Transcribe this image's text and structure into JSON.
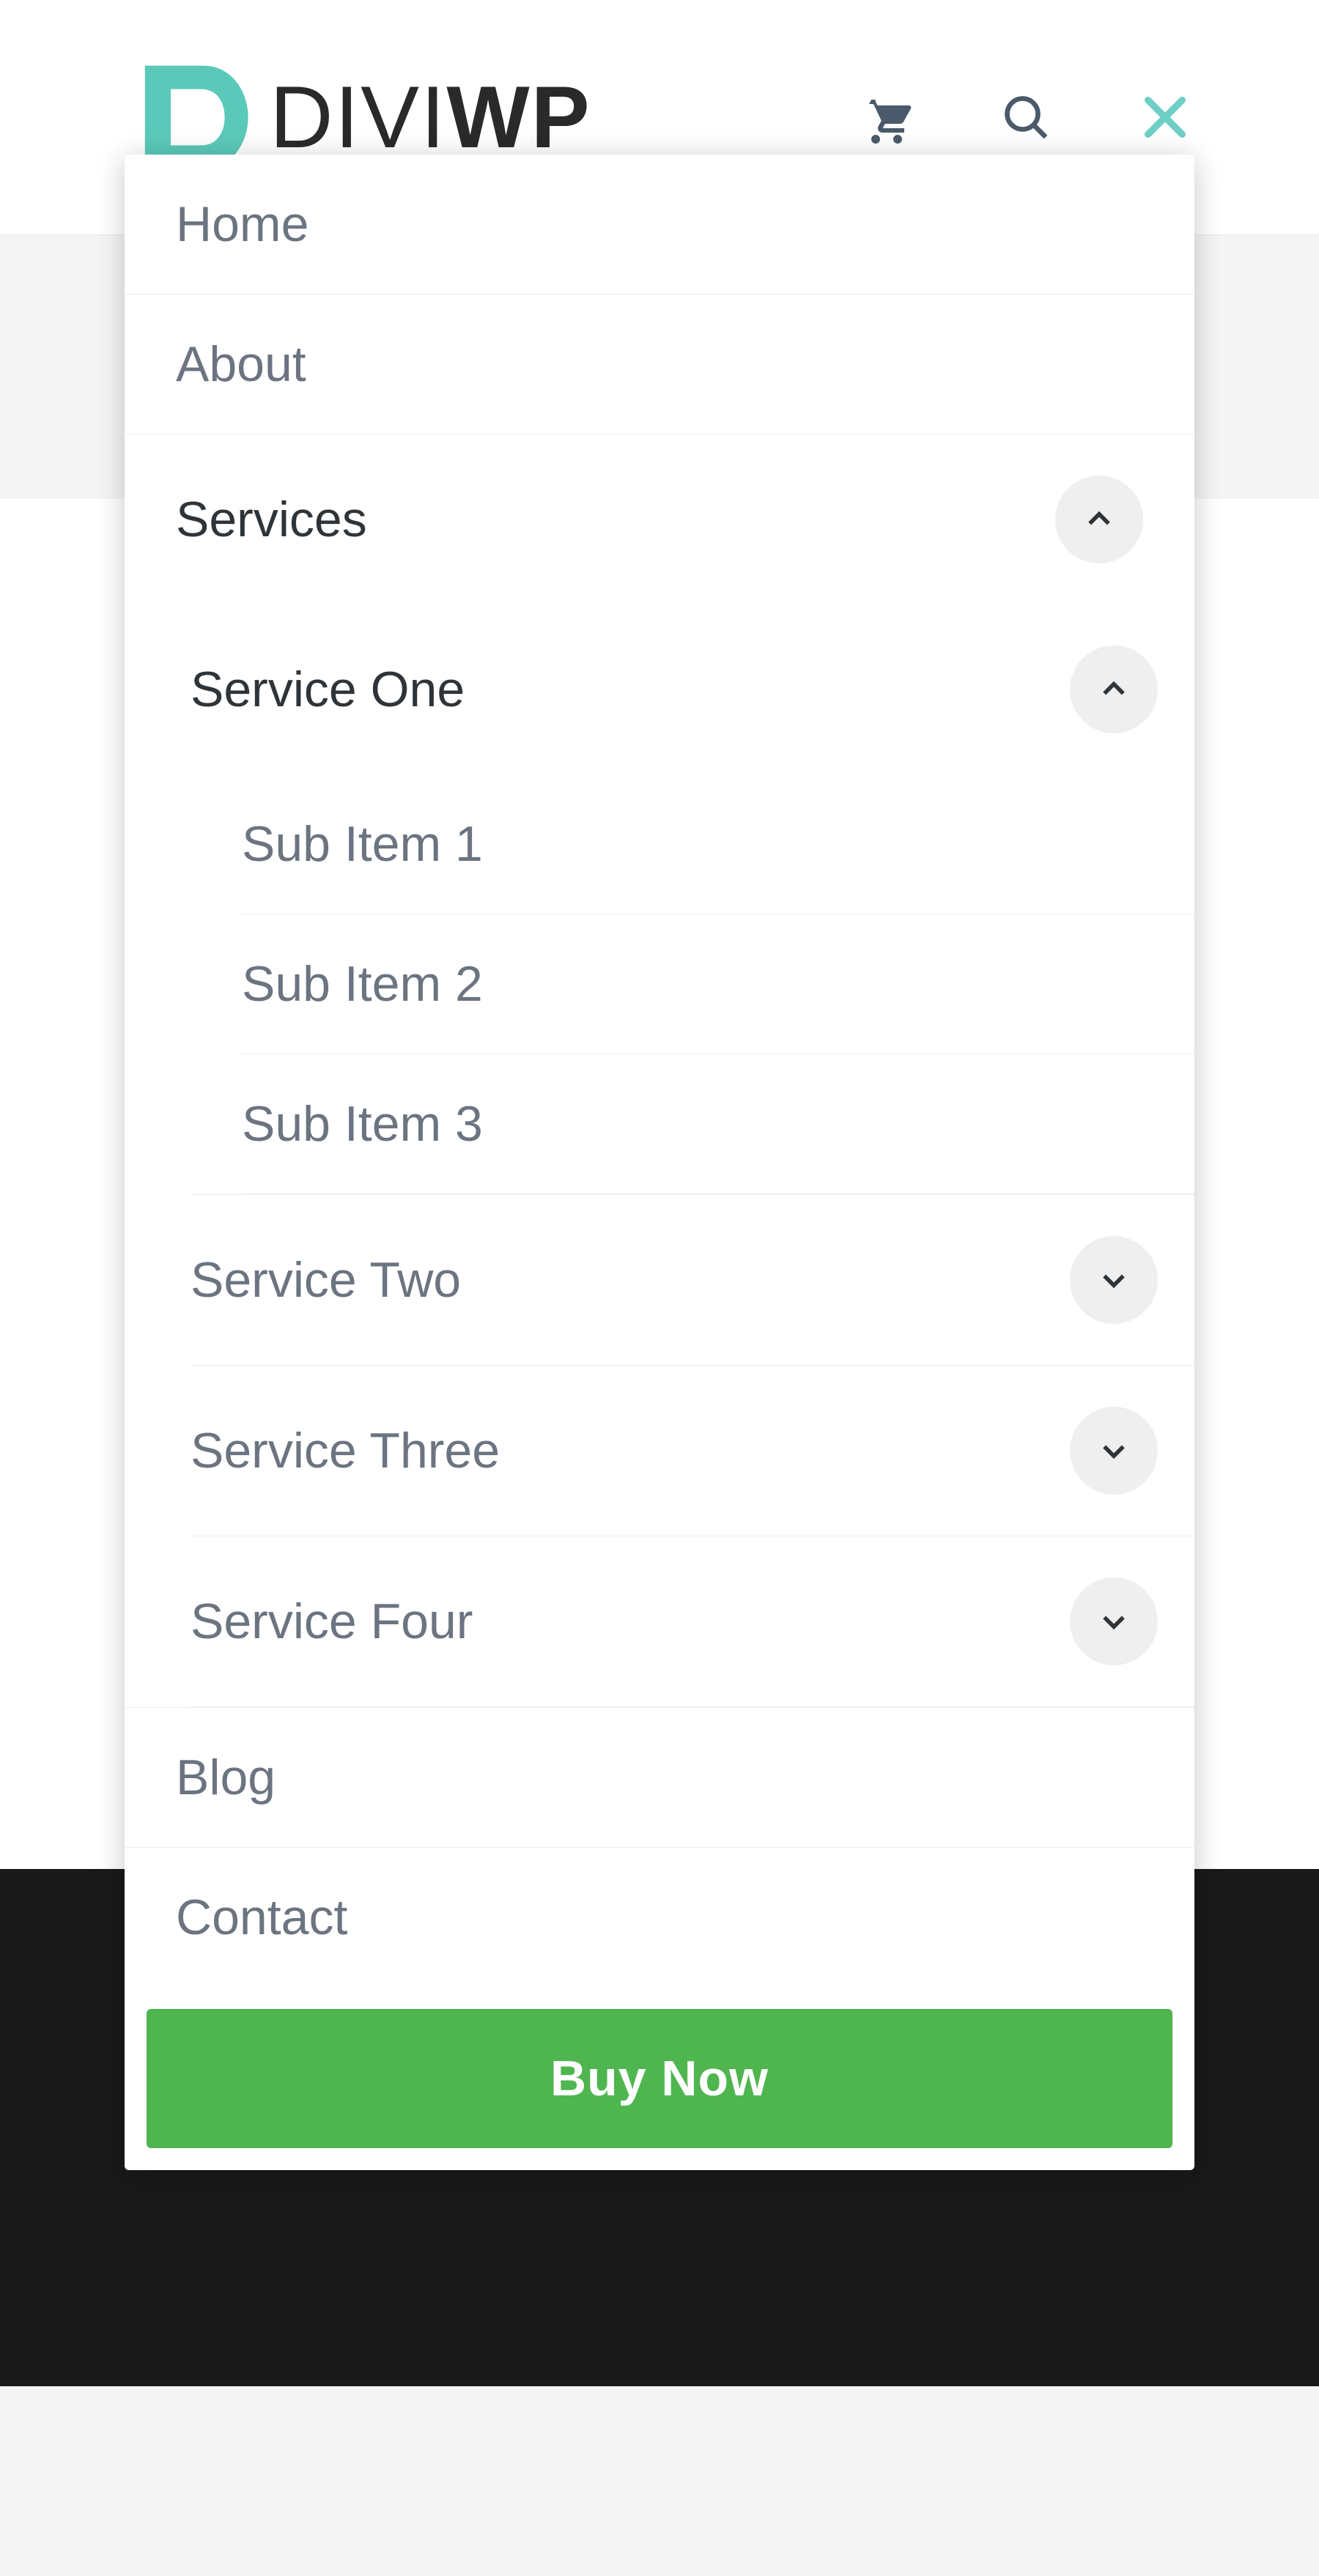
{
  "brand": {
    "name_part1": "DIVI",
    "name_part2": "WP",
    "accent": "#5bc9b9"
  },
  "header": {
    "icons": {
      "cart": "cart-icon",
      "search": "search-icon",
      "close": "close-icon"
    }
  },
  "menu": {
    "items": [
      {
        "label": "Home"
      },
      {
        "label": "About"
      },
      {
        "label": "Services",
        "expanded": true,
        "children": [
          {
            "label": "Service One",
            "expanded": true,
            "children": [
              {
                "label": "Sub Item 1"
              },
              {
                "label": "Sub Item 2"
              },
              {
                "label": "Sub Item 3"
              }
            ]
          },
          {
            "label": "Service Two",
            "expanded": false,
            "has_children": true
          },
          {
            "label": "Service Three",
            "expanded": false,
            "has_children": true
          },
          {
            "label": "Service Four",
            "expanded": false,
            "has_children": true
          }
        ]
      },
      {
        "label": "Blog"
      },
      {
        "label": "Contact"
      }
    ],
    "cta_label": "Buy Now"
  },
  "colors": {
    "text_muted": "#6b7480",
    "text_active": "#2f3438",
    "cta_bg": "#4fb54f",
    "close_icon": "#6ecfc7"
  }
}
